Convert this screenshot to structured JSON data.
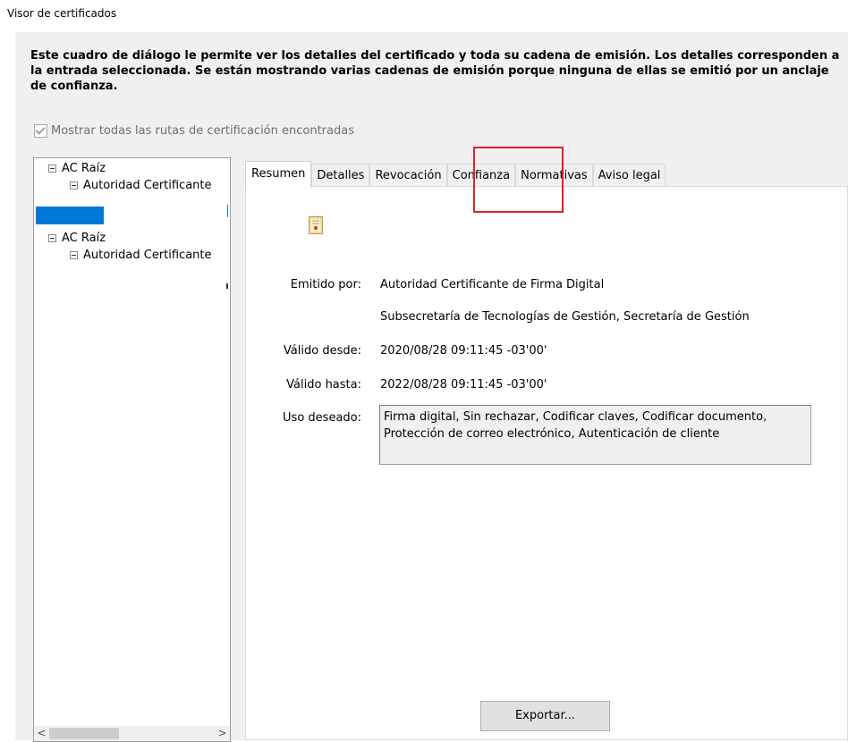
{
  "window": {
    "title": "Visor de certificados"
  },
  "description": "Este cuadro de diálogo le permite ver los detalles del certificado y toda su cadena de emisión. Los detalles corresponden a la entrada seleccionada. Se están mostrando varias cadenas de emisión porque ninguna de ellas se emitió por un anclaje de confianza.",
  "show_all": {
    "label": "Mostrar todas las rutas de certificación encontradas",
    "checked": true
  },
  "tree": {
    "nodes": [
      {
        "label": "AC Raíz"
      },
      {
        "label": "Autoridad Certificante"
      },
      {
        "label": "AC Raíz"
      },
      {
        "label": "Autoridad Certificante"
      }
    ],
    "scroll_left": "<",
    "scroll_right": ">"
  },
  "tabs": [
    {
      "label": "Resumen",
      "active": true
    },
    {
      "label": "Detalles"
    },
    {
      "label": "Revocación"
    },
    {
      "label": "Confianza"
    },
    {
      "label": "Normativas"
    },
    {
      "label": "Aviso legal"
    }
  ],
  "summary": {
    "issued_by_label": "Emitido por:",
    "issued_by_1": "Autoridad Certificante de Firma Digital",
    "issued_by_2": "Subsecretaría de Tecnologías de Gestión, Secretaría de Gestión",
    "valid_from_label": "Válido desde:",
    "valid_from": "2020/08/28 09:11:45 -03'00'",
    "valid_to_label": "Válido hasta:",
    "valid_to": "2022/08/28 09:11:45 -03'00'",
    "usage_label": "Uso deseado:",
    "usage": "Firma digital, Sin rechazar, Codificar claves, Codificar documento, Protección de correo electrónico, Autenticación de cliente"
  },
  "export_button": "Exportar...",
  "colors": {
    "selection": "#0078d7",
    "highlight": "#e0202a"
  },
  "icons": {
    "certificate": "certificate-icon"
  }
}
